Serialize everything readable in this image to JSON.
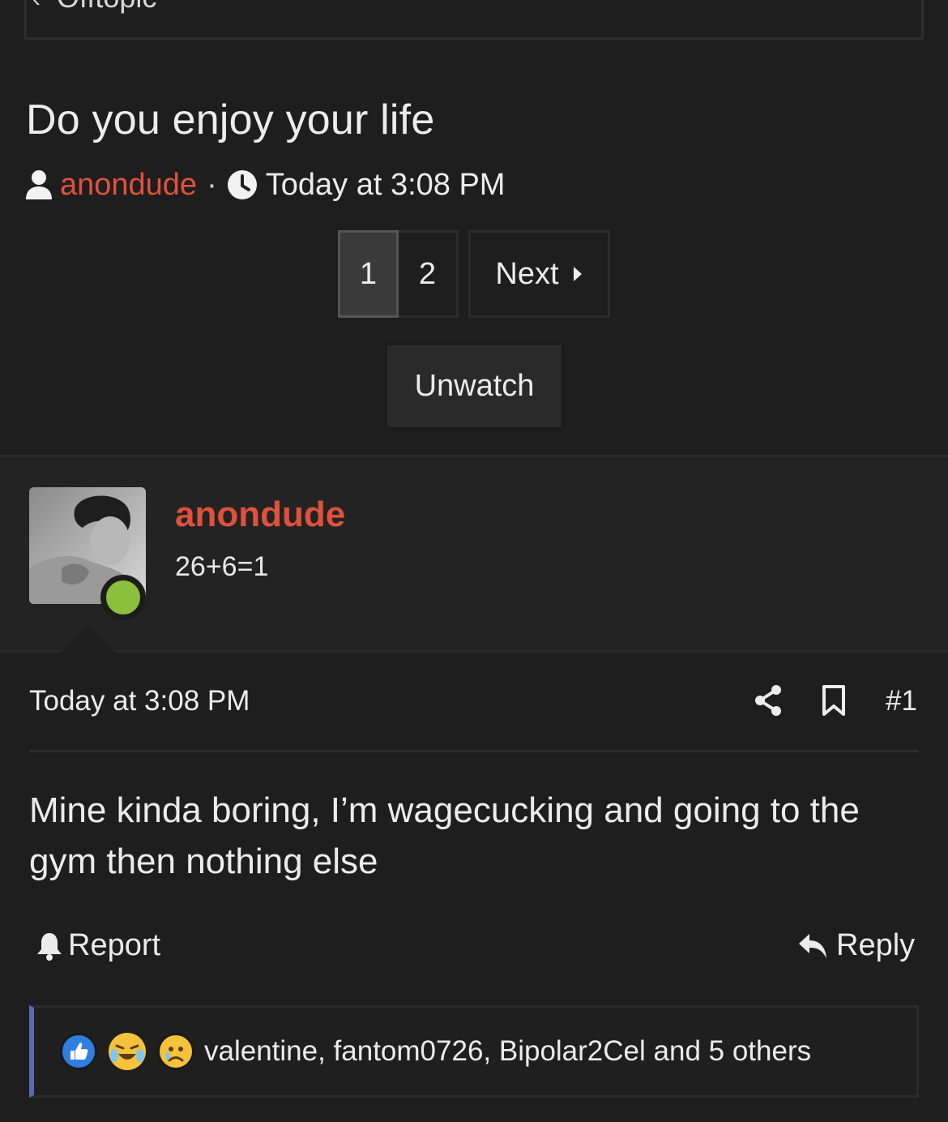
{
  "breadcrumb": {
    "label": "Offtopic"
  },
  "thread": {
    "title": "Do you enjoy your life",
    "author": "anondude",
    "separator": "·",
    "time": "Today at 3:08 PM"
  },
  "pagination": {
    "pages": [
      "1",
      "2"
    ],
    "current": "1",
    "next_label": "Next"
  },
  "watch_button": "Unwatch",
  "post": {
    "user": {
      "name": "anondude",
      "title": "26+6=1",
      "online": true
    },
    "time": "Today at 3:08 PM",
    "number": "#1",
    "body": "Mine kinda boring, I’m wagecucking and going to the gym then nothing else",
    "report_label": "Report",
    "reply_label": "Reply",
    "reactions": {
      "icons": [
        "like-icon",
        "laugh-cry-icon",
        "sad-icon"
      ],
      "summary": "valentine, fantom0726, Bipolar2Cel and 5 others"
    }
  },
  "colors": {
    "accent": "#e0513d",
    "online": "#8cbf3c",
    "reaction_bar": "#5a68b8",
    "background": "#1e1e1e"
  }
}
